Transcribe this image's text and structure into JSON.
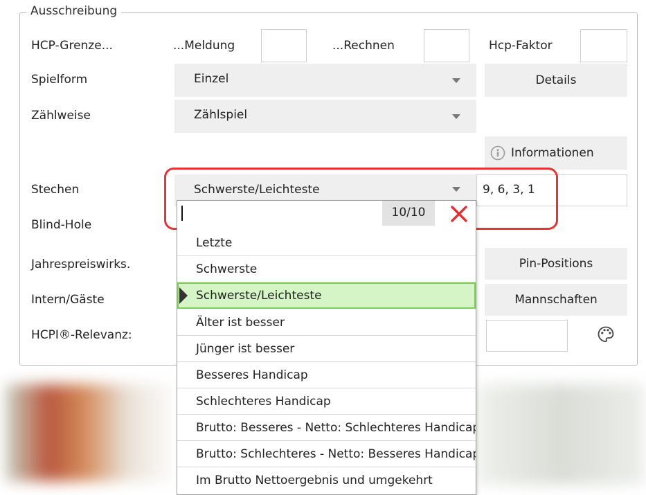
{
  "panel": {
    "legend": "Ausschreibung"
  },
  "rows": {
    "hcp_grenze": "HCP-Grenze...",
    "meldung": "...Meldung",
    "rechnen": "...Rechnen",
    "hcp_faktor": "Hcp-Faktor",
    "spielform": "Spielform",
    "zaehlweise": "Zählweise",
    "stechen": "Stechen",
    "blind_hole": "Blind-Hole",
    "jahrespreis": "Jahrespreiswirks.",
    "intern_gaeste": "Intern/Gäste",
    "hcpi_relevanz": "HCPI®-Relevanz:"
  },
  "selects": {
    "spielform": "Einzel",
    "zaehlweise": "Zählspiel",
    "stechen": "Schwerste/Leichteste"
  },
  "stechen_holes": "9, 6, 3, 1",
  "buttons": {
    "details": "Details",
    "informationen": "Informationen",
    "pin_positions": "Pin-Positions",
    "mannschaften": "Mannschaften"
  },
  "icons": {
    "info": "info-circle-icon",
    "palette": "palette-icon",
    "close": "close-x-icon",
    "dropdown": "chevron-down-icon"
  },
  "colors": {
    "highlight_frame": "#e33535",
    "selected_item_bg": "#d6f5c7",
    "selected_item_border": "#7ccf55",
    "close_x": "#e03030"
  },
  "dropdown": {
    "search_value": "",
    "counter": "10/10",
    "items": [
      "Letzte",
      "Schwerste",
      "Schwerste/Leichteste",
      "Älter ist besser",
      "Jünger ist besser",
      "Besseres Handicap",
      "Schlechteres Handicap",
      "Brutto: Besseres - Netto: Schlechteres Handicap",
      "Brutto: Schlechteres - Netto: Besseres Handicap",
      "Im Brutto Nettoergebnis und umgekehrt"
    ],
    "selected_index": 2
  }
}
